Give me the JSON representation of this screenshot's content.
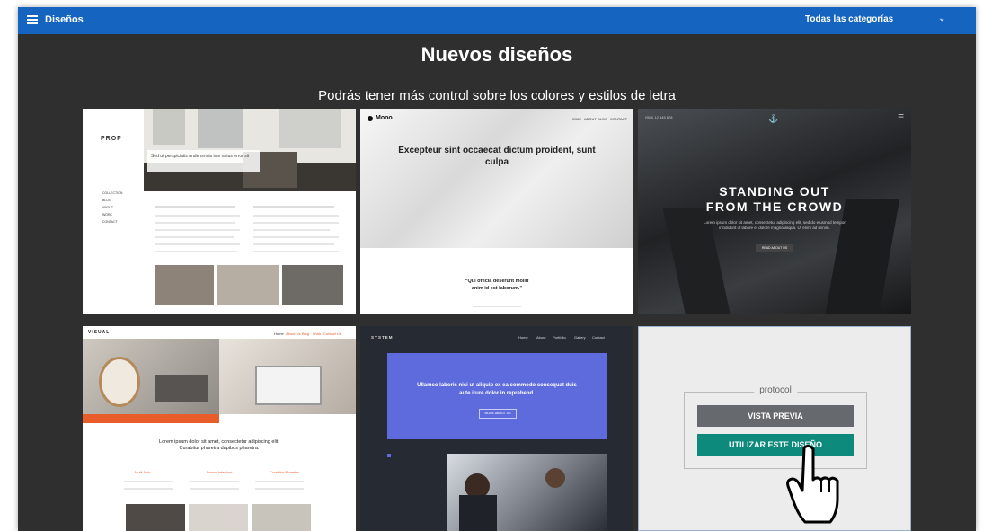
{
  "topbar": {
    "menu_icon": "menu-icon",
    "title": "Diseños",
    "category_select": "Todas las categorías",
    "chevron_icon": "chevron-down-icon"
  },
  "heading": "Nuevos diseños",
  "subheading": "Podrás tener más control sobre los colores y estilos de letra",
  "cards": [
    {
      "name": "prop",
      "logo": "PROP",
      "nav": [
        "COLLECTION",
        "BLOG",
        "ABOUT",
        "WORK",
        "CONTACT"
      ],
      "hero_caption": "Sed ut perspiciatis unde omnis iste natus error sit"
    },
    {
      "name": "mono",
      "logo": "Mono",
      "nav": [
        "HOME",
        "ABOUT",
        "BLOG",
        "CONTACT"
      ],
      "headline": "Excepteur sint occaecat dictum proident, sunt culpa",
      "quote": "“Qui officia deserunt mollit anim id est laborum.”"
    },
    {
      "name": "crowd",
      "phone": "(555) 12 345 678",
      "headline_1": "STANDING OUT",
      "headline_2": "FROM THE CROWD",
      "body": "Lorem ipsum dolor sit amet, consectetur adipiscing elit, sed do eiusmod tempor incididunt ut labore et dolore magna aliqua. Ut enim ad minim.",
      "button": "READ ABOUT US"
    },
    {
      "name": "visual",
      "logo": "VISUAL",
      "nav": [
        "Home",
        "About Us",
        "Blog",
        "Work",
        "Contact Us"
      ],
      "banner": "Collage",
      "headline": "Lorem ipsum dolor sit amet, consectetur adipiscing elit. Curabitur pharetra dapibus pharetra.",
      "columns": [
        "Multi Auto",
        "Donec Interdum",
        "Curabitur Pharetra"
      ]
    },
    {
      "name": "system",
      "logo": "SYSTEM",
      "nav": [
        "Home",
        "About",
        "Portfolio",
        "Gallery",
        "Contact"
      ],
      "headline": "Ullamco laboris nisi ut aliquip ex ea commodo consequat duis aute irure dolor in reprehend.",
      "button": "MORE ABOUT US"
    }
  ],
  "selected_card": {
    "name": "protocol",
    "preview_button": "VISTA PREVIA",
    "use_button": "UTILIZAR ESTE DISEÑO",
    "cursor_icon": "hand-pointer-icon"
  },
  "colors": {
    "topbar": "#1565c0",
    "background": "#2f2f2f",
    "use_button": "#0d8a7c",
    "preview_button": "#666a6e"
  }
}
